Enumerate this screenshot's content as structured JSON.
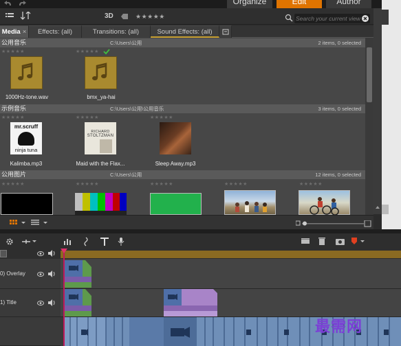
{
  "header": {
    "modes": [
      "Organize",
      "Edit",
      "Author"
    ],
    "active_mode": "Edit"
  },
  "toolbar": {
    "view_3d_label": "3D",
    "rating_filter": "★★★★★",
    "search_placeholder": "Search your current view"
  },
  "tabs": [
    {
      "label": "Media",
      "active": true
    },
    {
      "label": "Effects: (all)"
    },
    {
      "label": "Transitions: (all)"
    },
    {
      "label": "Sound Effects: (all)"
    }
  ],
  "library": {
    "sections": [
      {
        "name": "公用音乐",
        "path": "C:\\Users\\公用",
        "count": "2 items, 0 selected",
        "items": [
          {
            "label": "1000Hz-tone.wav",
            "stars": "★★★★★",
            "thumb": "music-icon"
          },
          {
            "label": "bmx_ya-hai",
            "stars": "★★★★★",
            "thumb": "music-icon",
            "checked": true
          }
        ]
      },
      {
        "name": "示例音乐",
        "path": "C:\\Users\\公用\\公用音乐",
        "count": "3 items, 0 selected",
        "items": [
          {
            "label": "Kalimba.mp3",
            "stars": "★★★★★",
            "thumb": "album-mrscruff",
            "art_text": [
              "mr.scruff",
              "ninja tuna"
            ]
          },
          {
            "label": "Maid with the Flax...",
            "stars": "★★★★★",
            "thumb": "album-stoltzman",
            "art_text": [
              "RICHARD",
              "STOLTZMAN"
            ]
          },
          {
            "label": "Sleep Away.mp3",
            "stars": "★★★★★",
            "thumb": "album-sleepaway"
          }
        ]
      },
      {
        "name": "公用图片",
        "path": "C:\\Users\\公用",
        "count": "12 items, 0 selected",
        "items": [
          {
            "stars": "★★★★★",
            "thumb": "black-frame"
          },
          {
            "stars": "★★★★★",
            "thumb": "color-bars"
          },
          {
            "stars": "★★★★★",
            "thumb": "green-frame"
          },
          {
            "stars": "★★★★★",
            "thumb": "photo-group"
          },
          {
            "stars": "★★★★★",
            "thumb": "photo-bikes"
          }
        ]
      }
    ]
  },
  "timeline": {
    "tracks": [
      {
        "name": "0) Overlay"
      },
      {
        "name": "1) Title"
      }
    ]
  },
  "watermark": "最需网",
  "colors": {
    "accent": "#f07a00",
    "playhead": "#c0185a",
    "ruler": "#8a6a22",
    "tab_underline": "#c8a030"
  }
}
